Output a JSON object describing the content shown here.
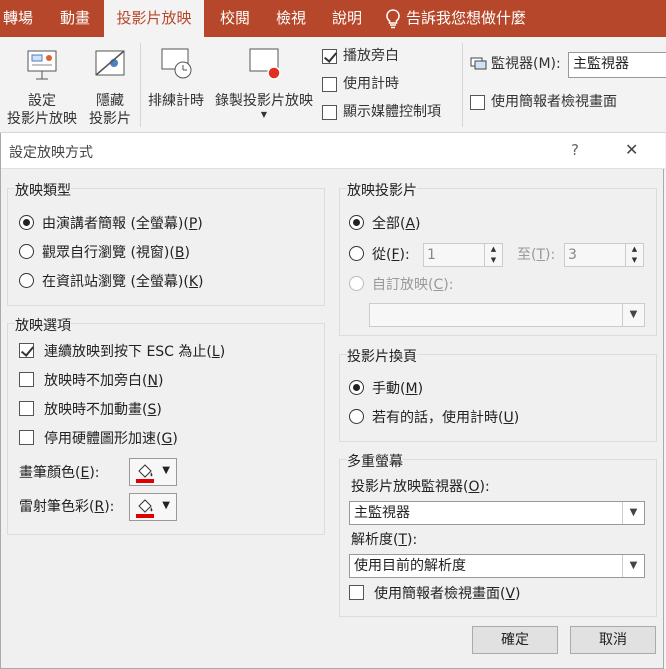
{
  "ribbon": {
    "tabs": [
      "轉場",
      "動畫",
      "投影片放映",
      "校閱",
      "檢視",
      "說明",
      "告訴我您想做什麼"
    ],
    "buttons": {
      "setup_line1": "設定",
      "setup_line2": "投影片放映",
      "hide_line1": "隱藏",
      "hide_line2": "投影片",
      "rehearse": "排練計時",
      "record": "錄製投影片放映"
    },
    "checks": {
      "play_narration": "播放旁白",
      "use_timings": "使用計時",
      "show_media_controls": "顯示媒體控制項"
    },
    "monitor_label": "監視器(M):",
    "monitor_value": "主監視器",
    "presenter_view": "使用簡報者檢視畫面"
  },
  "dialog": {
    "title": "設定放映方式",
    "help": "?",
    "close": "✕",
    "show_type": {
      "title": "放映類型",
      "opt_presenter": [
        "由演講者簡報 (全螢幕)(",
        "P",
        ")"
      ],
      "opt_individual": [
        "觀眾自行瀏覽 (視窗)(",
        "B",
        ")"
      ],
      "opt_kiosk": [
        "在資訊站瀏覽 (全螢幕)(",
        "K",
        ")"
      ]
    },
    "show_options": {
      "title": "放映選項",
      "loop": [
        "連續放映到按下 ESC 為止(",
        "L",
        ")"
      ],
      "no_narration": [
        "放映時不加旁白(",
        "N",
        ")"
      ],
      "no_animation": [
        "放映時不加動畫(",
        "S",
        ")"
      ],
      "no_hw_accel": [
        "停用硬體圖形加速(",
        "G",
        ")"
      ],
      "pen_color": [
        "畫筆顏色(",
        "E",
        "):"
      ],
      "laser_color": [
        "雷射筆色彩(",
        "R",
        "):"
      ],
      "pen_swatch": "#e00000",
      "laser_swatch": "#e00000"
    },
    "show_slides": {
      "title": "放映投影片",
      "all": [
        "全部(",
        "A",
        ")"
      ],
      "from": [
        "從(",
        "F",
        "):"
      ],
      "from_value": "1",
      "to": [
        "至(",
        "T",
        "):"
      ],
      "to_value": "3",
      "custom": [
        "自訂放映(",
        "C",
        "):"
      ],
      "custom_value": ""
    },
    "advance": {
      "title": "投影片換頁",
      "manual": [
        "手動(",
        "M",
        ")"
      ],
      "timings": [
        "若有的話，使用計時(",
        "U",
        ")"
      ]
    },
    "multiple_monitors": {
      "title": "多重螢幕",
      "monitor_label": [
        "投影片放映監視器(",
        "O",
        "):"
      ],
      "monitor_value": "主監視器",
      "resolution_label": [
        "解析度(",
        "T",
        "):"
      ],
      "resolution_value": "使用目前的解析度",
      "presenter_view": [
        "使用簡報者檢視畫面(",
        "V",
        ")"
      ]
    },
    "ok": "確定",
    "cancel": "取消"
  },
  "colors": {
    "accent": "#b7472a",
    "swatch": "#e00000"
  }
}
